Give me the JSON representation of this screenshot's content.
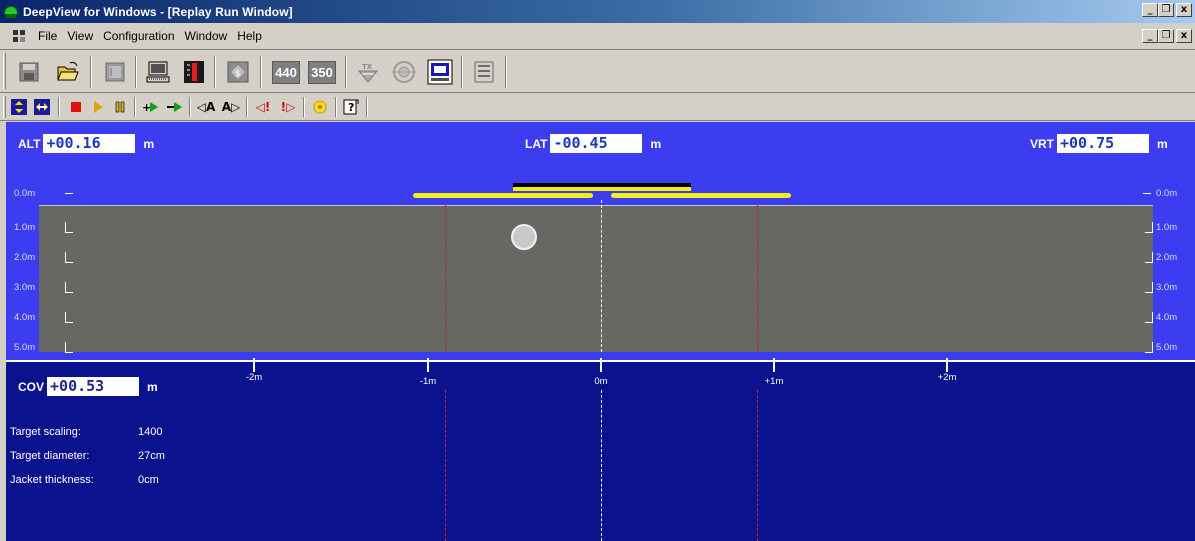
{
  "window": {
    "title": "DeepView for Windows - [Replay Run Window]",
    "minimize": "_",
    "restore": "ǝ",
    "close": "x"
  },
  "menu": {
    "items": [
      "File",
      "View",
      "Configuration",
      "Window",
      "Help"
    ]
  },
  "toolbar": {
    "btn_440": "440",
    "btn_350": "350",
    "playback": {
      "tool_a_left": "◁A",
      "tool_a_right": "A▷",
      "flag_left": "◁!",
      "flag_right": "!▷"
    }
  },
  "readouts": {
    "alt_label": "ALT",
    "alt_value": "+00.16",
    "alt_unit": "m",
    "lat_label": "LAT",
    "lat_value": "-00.45",
    "lat_unit": "m",
    "vrt_label": "VRT",
    "vrt_value": "+00.75",
    "vrt_unit": "m",
    "cov_label": "COV",
    "cov_value": "+00.53",
    "cov_unit": "m"
  },
  "depth_scale": [
    "0.0m",
    "1.0m",
    "2.0m",
    "3.0m",
    "4.0m",
    "5.0m"
  ],
  "lateral_scale": [
    "-2m",
    "-1m",
    "0m",
    "+1m",
    "+2m"
  ],
  "target_info": [
    {
      "label": "Target scaling:",
      "value": "1400"
    },
    {
      "label": "Target diameter:",
      "value": "27cm"
    },
    {
      "label": "Jacket thickness:",
      "value": "0cm"
    }
  ],
  "colors": {
    "upper_panel": "#3c3cf0",
    "lower_panel": "#0b128d",
    "ground": "#676763",
    "sensor_bar": "#f2ee1a"
  }
}
